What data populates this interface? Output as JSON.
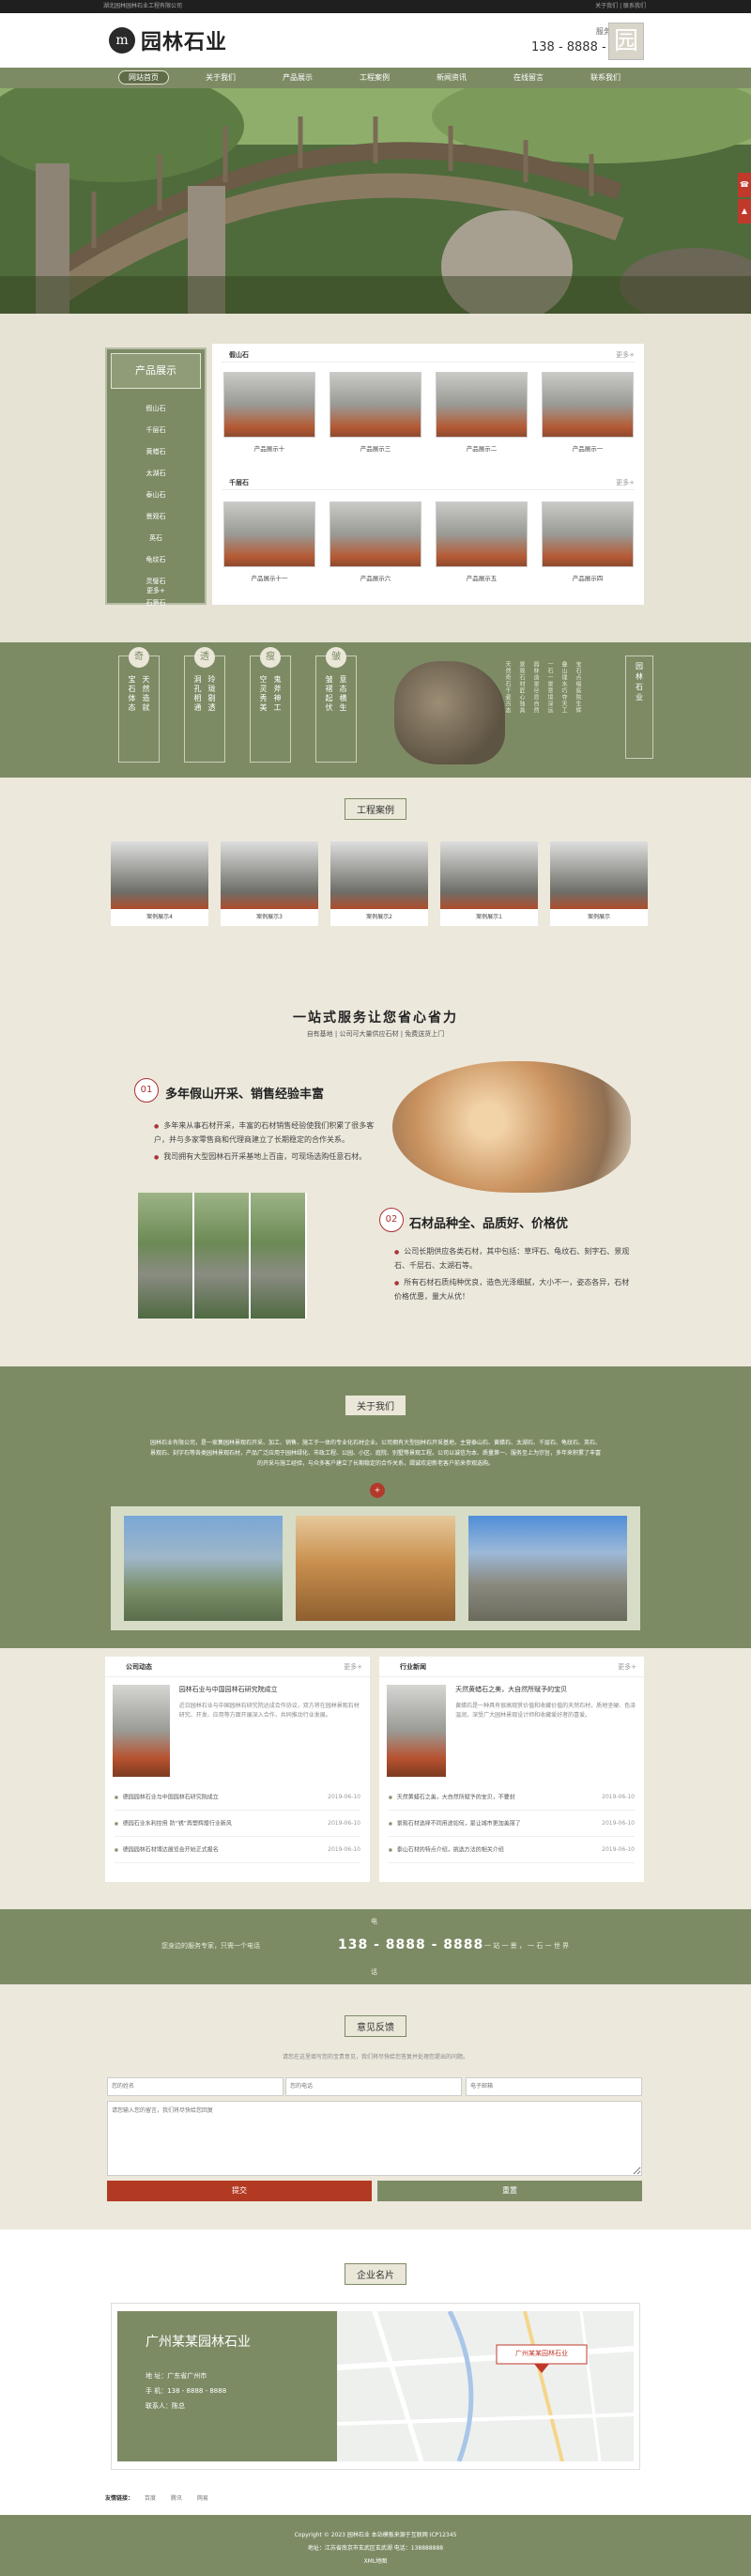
{
  "topbar": {
    "left": "湖北园林园林石业工程有限公司",
    "right": "关于我们 | 联系我们"
  },
  "header": {
    "logo_mark": "m",
    "site_name": "园林石业",
    "hotline_label": "服务咨询热线",
    "hotline": "138 - 8888 - 8888",
    "seal_char": "园"
  },
  "nav": [
    "网站首页",
    "关于我们",
    "产品展示",
    "工程案例",
    "新闻资讯",
    "在线留言",
    "联系我们"
  ],
  "products": {
    "sidebar_title": "产品展示",
    "categories": [
      "假山石",
      "千层石",
      "黄蜡石",
      "太湖石",
      "泰山石",
      "景观石",
      "英石",
      "龟纹石",
      "灵璧石",
      "石笋石"
    ],
    "sidebar_more": "更多+",
    "groups": [
      {
        "name": "假山石",
        "more": "更多+",
        "items": [
          "产品展示十",
          "产品展示三",
          "产品展示二",
          "产品展示一"
        ]
      },
      {
        "name": "千层石",
        "more": "更多+",
        "items": [
          "产品展示十一",
          "产品展示六",
          "产品展示五",
          "产品展示四"
        ]
      }
    ]
  },
  "features": [
    {
      "badge": "奇",
      "lines": [
        "宝石体态",
        "天然造就"
      ]
    },
    {
      "badge": "透",
      "lines": [
        "洞孔相通",
        "玲珑剔透"
      ]
    },
    {
      "badge": "瘦",
      "lines": [
        "空灵秀美",
        "鬼斧神工"
      ]
    },
    {
      "badge": "皱",
      "lines": [
        "皱褶起伏",
        "意态横生"
      ]
    }
  ],
  "poem": {
    "title": "园林石业",
    "lines": [
      "天然奇石千姿百态",
      "景观石材匠心独具",
      "园林造景尽显自然",
      "一石一景意境深远",
      "叠山理水巧夺天工",
      "宝石点缀庭院生辉"
    ]
  },
  "cases": {
    "title": "工程案例",
    "items": [
      "案例展示4",
      "案例展示3",
      "案例展示2",
      "案例展示1",
      "案例展示"
    ]
  },
  "advantages": {
    "headline": "一站式服务让您省心省力",
    "sub": "自有基地 | 公司可大量供应石材 | 免费送货上门",
    "items": [
      {
        "num": "01",
        "title": "多年假山开采、销售经验丰富",
        "points": [
          "多年来从事石材开采，丰富的石材销售经验使我们积累了很多客户，并与多家零售商和代理商建立了长期稳定的合作关系。",
          "我司拥有大型园林石开采基地上百亩，可现场选购任意石材。"
        ]
      },
      {
        "num": "02",
        "title": "石材品种全、品质好、价格优",
        "points": [
          "公司长期供应各类石材，其中包括：草坪石、龟纹石、刻字石、景观石、千层石、太湖石等。",
          "所有石材石质纯种优良，造色光泽细腻，大小不一，姿态各异，石材价格优惠，量大从优！"
        ]
      }
    ]
  },
  "about": {
    "title": "关于我们",
    "text": "园林石业有限公司，是一家集园林景观石开采、加工、销售、施工于一体的专业化石材企业。公司拥有大型园林石开采基地，主营泰山石、黄蜡石、太湖石、千层石、龟纹石、英石、景观石、刻字石等各类园林景观石材，产品广泛应用于园林绿化、市政工程、公园、小区、庭院、别墅等景观工程。公司以诚信为本、质量第一、服务至上为宗旨，多年来积累了丰富的开采与施工经验，与众多客户建立了长期稳定的合作关系，竭诚欢迎新老客户前来参观选购。",
    "dot": "+"
  },
  "news": [
    {
      "title": "公司动态",
      "more": "更多+",
      "top_title": "园林石业与中国园林石研究院成立",
      "top_desc": "近日园林石业与中国园林石研究院达成合作协议，双方将在园林景观石材研究、开发、应用等方面开展深入合作，共同推动行业发展。",
      "list": [
        {
          "t": "德园园林石业与中国园林石研究院成立",
          "d": "2019-06-10"
        },
        {
          "t": "德园石业水利控用 防“锈”再塑辉煌行业新风",
          "d": "2019-06-10"
        },
        {
          "t": "德园园林石材博达展览会开始正式报名",
          "d": "2019-06-10"
        }
      ]
    },
    {
      "title": "行业新闻",
      "more": "更多+",
      "top_title": "天然黄蜡石之美，大自然所赋予的宝贝",
      "top_desc": "黄蜡石是一种具有很高观赏价值和收藏价值的天然石材，质地坚硬、色泽温润，深受广大园林景观设计师和收藏爱好者的喜爱。",
      "list": [
        {
          "t": "天然黄蜡石之美，大自然所赋予的宝贝，不要封",
          "d": "2019-06-10"
        },
        {
          "t": "景观石材选择不同用途如何，是让城市更加美丽了",
          "d": "2019-06-10"
        },
        {
          "t": "泰山石材的特点介绍，挑选方法的相关介绍",
          "d": "2019-06-10"
        }
      ]
    }
  ],
  "hotline_band": {
    "left": "您身边的服务专家，只需一个电话",
    "top": "电",
    "number": "138 - 8888 - 8888",
    "bottom": "话",
    "right": "一 站 一 景 ， 一 石 一 世 界"
  },
  "feedback": {
    "title": "意见反馈",
    "intro": "请您在这里填写您的宝贵意见，我们将尽快给您答复并处理您提出的问题。",
    "name_ph": "您的姓名",
    "phone_ph": "您的电话",
    "email_ph": "电子邮箱",
    "msg_ph": "请您输入您的留言，我们将尽快给您回复",
    "submit": "提交",
    "reset": "重置"
  },
  "business_card": {
    "title": "企业名片",
    "company": "广州某某园林石业",
    "address": "地  址：广东省广州市",
    "phone": "手  机：138 - 8888 - 8888",
    "contact": "联系人：陈总",
    "map_label": "广州某某园林石业"
  },
  "links": {
    "label": "友情链接：",
    "items": [
      "百度",
      "腾讯",
      "网易"
    ]
  },
  "footer": {
    "line1": "Copyright © 2023 园林石业 本站模板来源于互联网  ICP12345",
    "line2": "地址：江苏省南京市玄武区玄武湖  电话：138888888",
    "line3": "XML地图"
  }
}
